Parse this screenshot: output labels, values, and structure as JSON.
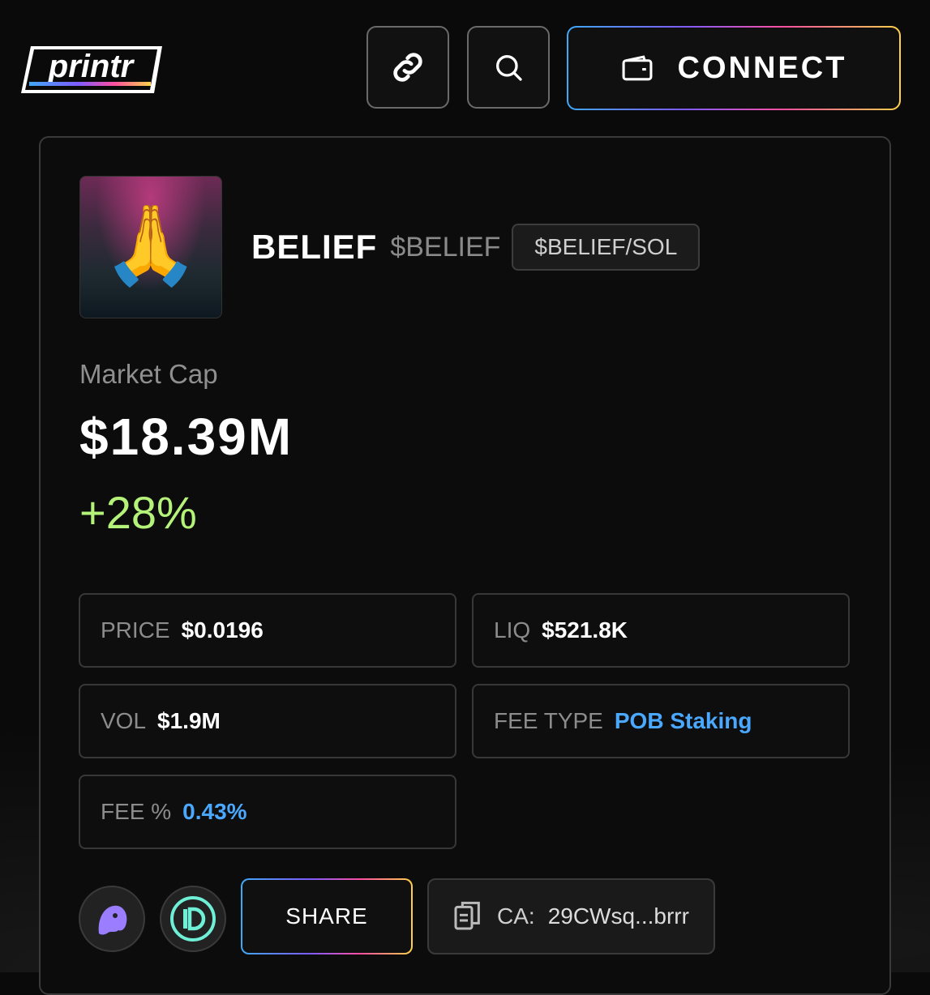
{
  "header": {
    "logo_text": "printr",
    "connect_label": "CONNECT"
  },
  "token": {
    "name": "BELIEF",
    "ticker": "$BELIEF",
    "pair": "$BELIEF/SOL",
    "image_emoji": "🙏"
  },
  "market": {
    "cap_label": "Market Cap",
    "cap_value": "$18.39M",
    "change": "+28%"
  },
  "stats": {
    "price_label": "PRICE",
    "price_value": "$0.0196",
    "liq_label": "LIQ",
    "liq_value": "$521.8K",
    "vol_label": "VOL",
    "vol_value": "$1.9M",
    "fee_type_label": "FEE TYPE",
    "fee_type_value": "POB Staking",
    "fee_pct_label": "FEE %",
    "fee_pct_value": "0.43%"
  },
  "actions": {
    "share_label": "SHARE",
    "ca_label": "CA:",
    "ca_value": "29CWsq...brrr"
  },
  "colors": {
    "accent_green": "#b5f27a",
    "accent_blue": "#4aa8ff",
    "background": "#0a0a0a"
  },
  "icons": [
    "link-icon",
    "search-icon",
    "wallet-icon",
    "prayer-emoji",
    "ghost-icon",
    "d-logo-icon",
    "clipboard-icon"
  ]
}
